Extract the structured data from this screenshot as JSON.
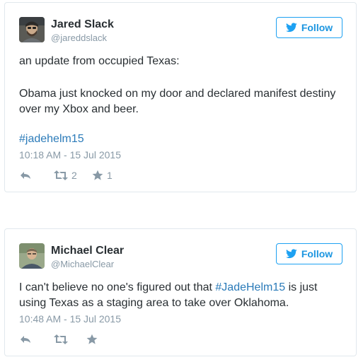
{
  "colors": {
    "brand_blue": "#1da1f2",
    "link_blue": "#2b7bb9",
    "muted_gray": "#8899a6",
    "text_dark": "#292f33",
    "border": "#e1e8ed"
  },
  "tweets": [
    {
      "author": {
        "name": "Jared Slack",
        "handle": "@jareddslack",
        "avatar_icon": "avatar-photo"
      },
      "follow_label": "Follow",
      "text_lines": [
        "an update from occupied Texas:",
        "",
        "Obama just knocked on my door and declared manifest destiny",
        "over my Xbox and beer.",
        ""
      ],
      "hashtag": "#jadehelm15",
      "timestamp": "10:18 AM - 15 Jul 2015",
      "actions": {
        "reply_icon": "reply-icon",
        "retweet_icon": "retweet-icon",
        "retweet_count": "2",
        "favorite_icon": "star-icon",
        "favorite_count": "1"
      }
    },
    {
      "author": {
        "name": "Michael Clear",
        "handle": "@MichaelClear",
        "avatar_icon": "avatar-photo"
      },
      "follow_label": "Follow",
      "text_part1": "I can't believe no one's figured out that ",
      "hashtag": "#JadeHelm15",
      "text_part2": " is just",
      "text_line2": "using Texas as a staging area to take over Oklahoma.",
      "timestamp": "10:48 AM - 15 Jul 2015",
      "actions": {
        "reply_icon": "reply-icon",
        "retweet_icon": "retweet-icon",
        "retweet_count": "",
        "favorite_icon": "star-icon",
        "favorite_count": ""
      }
    }
  ]
}
